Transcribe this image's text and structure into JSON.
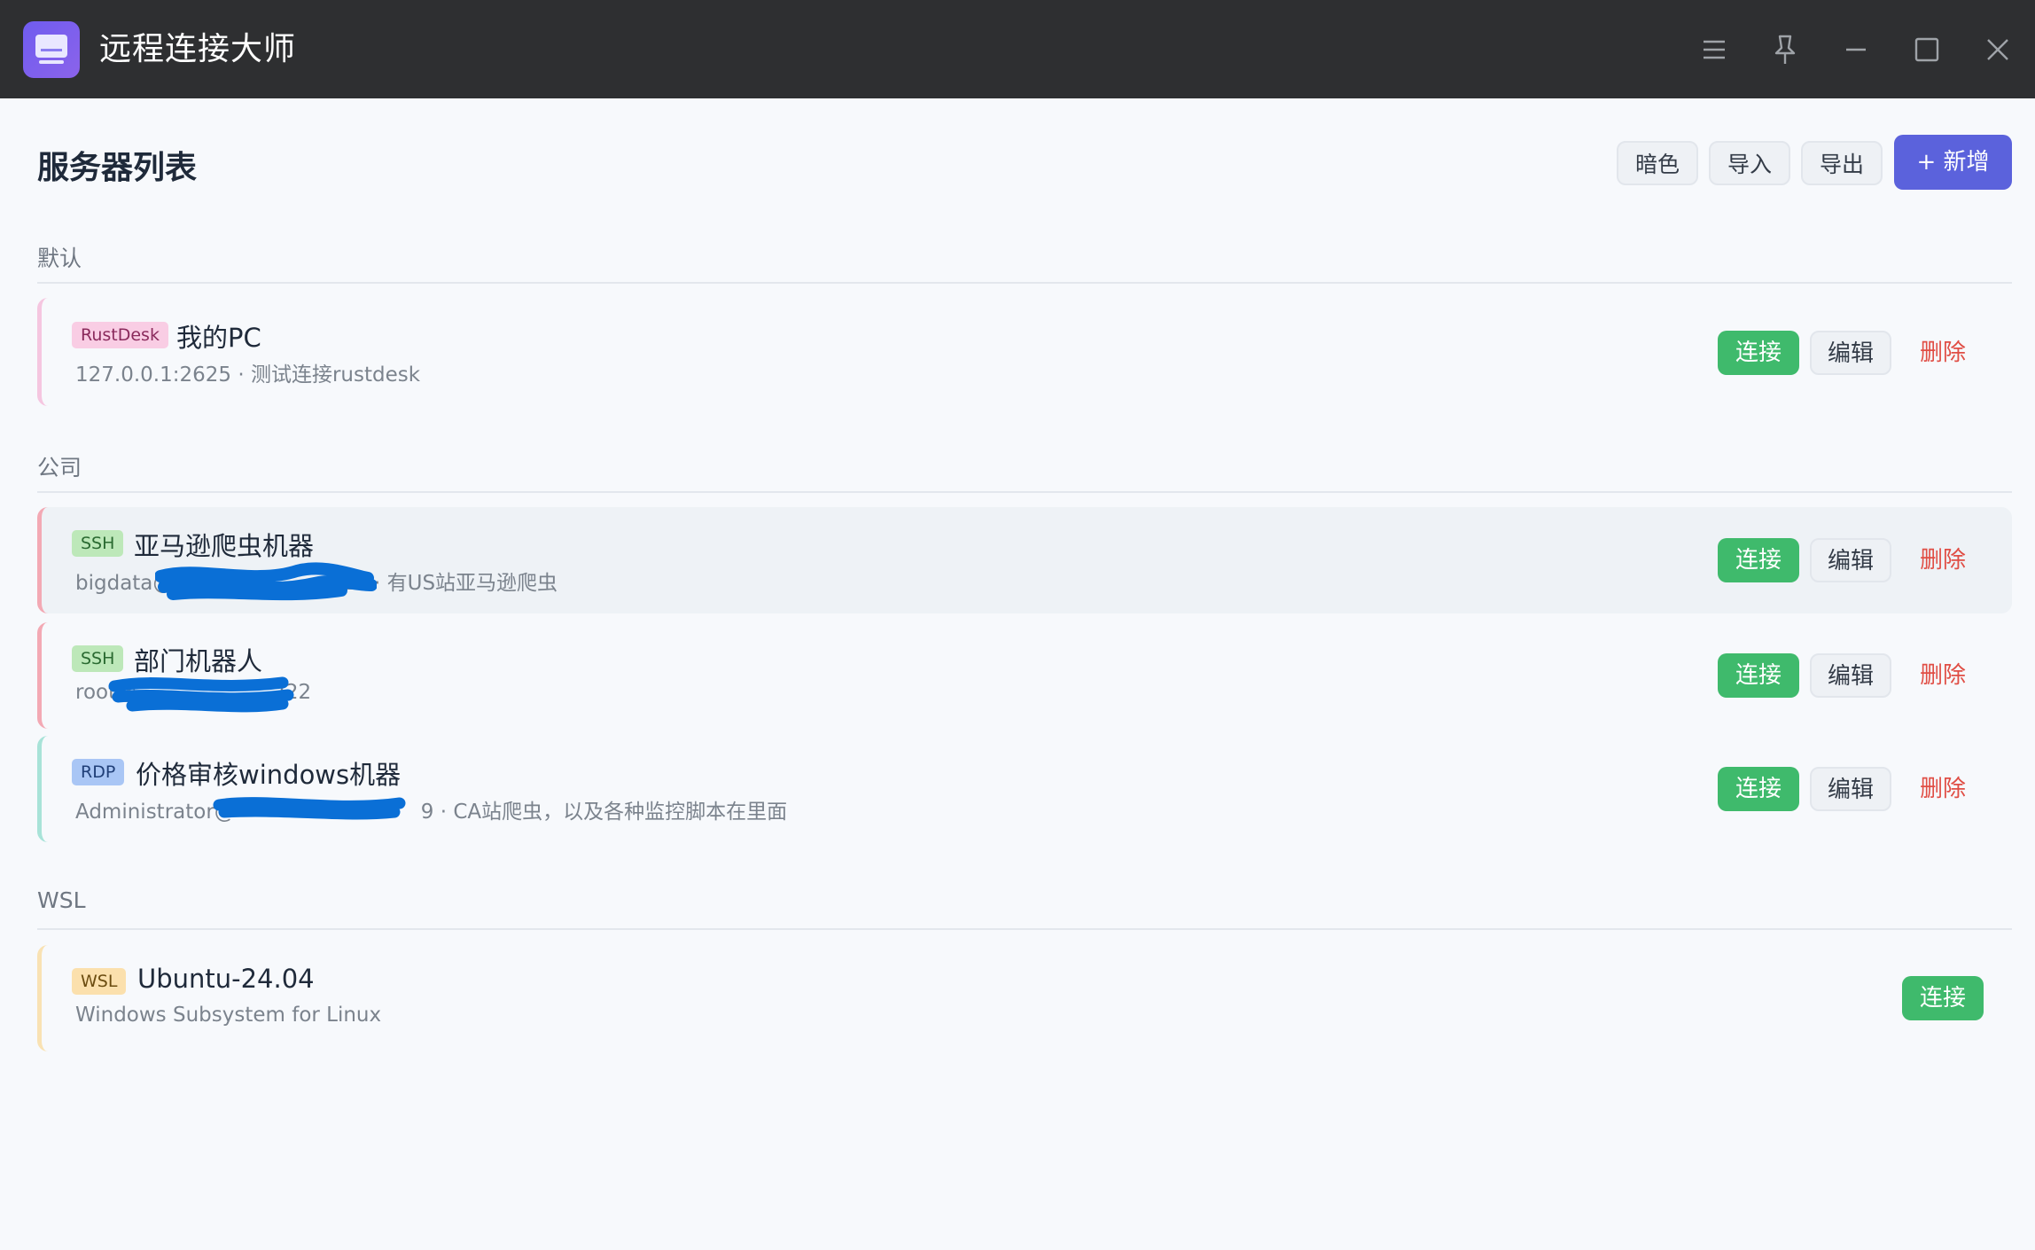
{
  "window": {
    "title": "远程连接大师",
    "icons": [
      "menu-icon",
      "pin-icon",
      "minimize-icon",
      "maximize-icon",
      "close-icon"
    ]
  },
  "header": {
    "title": "服务器列表",
    "buttons": {
      "theme": "暗色",
      "import": "导入",
      "export": "导出",
      "add": "+ 新增"
    }
  },
  "labels": {
    "connect": "连接",
    "edit": "编辑",
    "delete": "删除"
  },
  "groups": [
    {
      "name": "默认",
      "items": [
        {
          "tag": "RustDesk",
          "name": "我的PC",
          "meta": "127.0.0.1:2625 · 测试连接rustdesk",
          "accent": "#f5c6e0",
          "tag_bg": "#f9cde4",
          "tag_color": "#8a2a5c"
        }
      ]
    },
    {
      "name": "公司",
      "items": [
        {
          "tag": "SSH",
          "name": "亚马逊爬虫机器",
          "meta_prefix": "bigdata@",
          "meta_suffix": "22 · 有US站亚马逊爬虫",
          "accent": "#f3a9b4",
          "tag_bg": "#bde8b9",
          "tag_color": "#2a6a31"
        },
        {
          "tag": "SSH",
          "name": "部门机器人",
          "meta_prefix": "root@",
          "meta_suffix": ":22",
          "accent": "#f3a9b4",
          "tag_bg": "#bde8b9",
          "tag_color": "#2a6a31"
        },
        {
          "tag": "RDP",
          "name": "价格审核windows机器",
          "meta_prefix": "Administrator@",
          "meta_suffix": "9 · CA站爬虫，以及各种监控脚本在里面",
          "accent": "#a8e3d8",
          "tag_bg": "#a9c6f5",
          "tag_color": "#203f78"
        }
      ]
    },
    {
      "name": "WSL",
      "items": [
        {
          "tag": "WSL",
          "name": "Ubuntu-24.04",
          "meta": "Windows Subsystem for Linux",
          "accent": "#f9e2b3",
          "tag_bg": "#fbe0ad",
          "tag_color": "#6b4c10"
        }
      ]
    }
  ],
  "colors": {
    "titlebar": "#2e2f31",
    "primary": "#5b62dc",
    "connect": "#3fba6c",
    "delete": "#e04e45",
    "redaction": "#0a6fd6"
  }
}
